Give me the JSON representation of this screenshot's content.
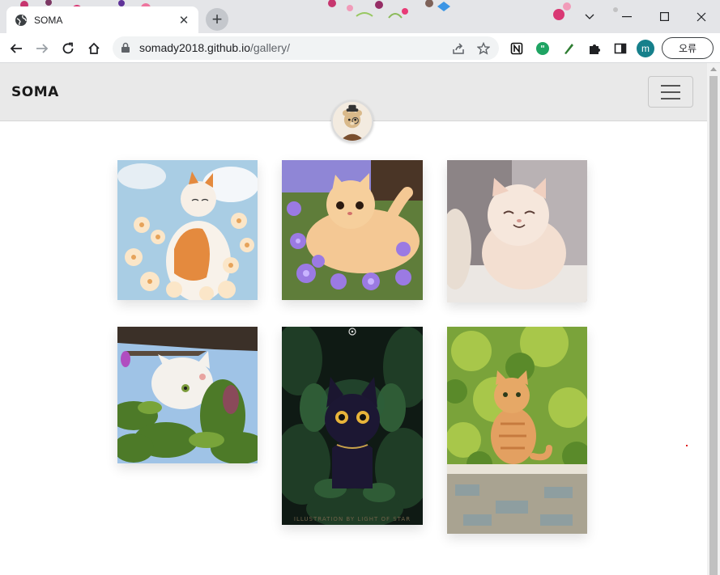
{
  "browser": {
    "tab_title": "SOMA",
    "url_host": "somady2018.github.io",
    "url_path": "/gallery/",
    "profile_initial": "m",
    "error_button_label": "오류"
  },
  "site": {
    "brand": "SOMA"
  },
  "gallery": {
    "thumbnails": [
      {
        "name": "orange-white-cat-with-flowers"
      },
      {
        "name": "cat-in-purple-flowers"
      },
      {
        "name": "smiling-fluffy-cat"
      },
      {
        "name": "white-cat-peeking-leaves"
      },
      {
        "name": "black-cat-jungle",
        "caption": "ILLUSTRATION BY LIGHT OF STAR"
      },
      {
        "name": "tabby-cat-on-wall"
      }
    ]
  },
  "colors": {
    "nav_bg": "#e9e9e9",
    "profile": "#16808b"
  },
  "icons": [
    "globe-icon",
    "close-icon",
    "plus-icon",
    "back-icon",
    "forward-icon",
    "reload-icon",
    "home-icon",
    "lock-icon",
    "share-icon",
    "star-icon",
    "notion-icon",
    "quote-icon",
    "pen-icon",
    "puzzle-icon",
    "sidepanel-icon",
    "chevron-down-icon",
    "minimize-icon",
    "maximize-icon",
    "close-window-icon",
    "hamburger-icon"
  ]
}
